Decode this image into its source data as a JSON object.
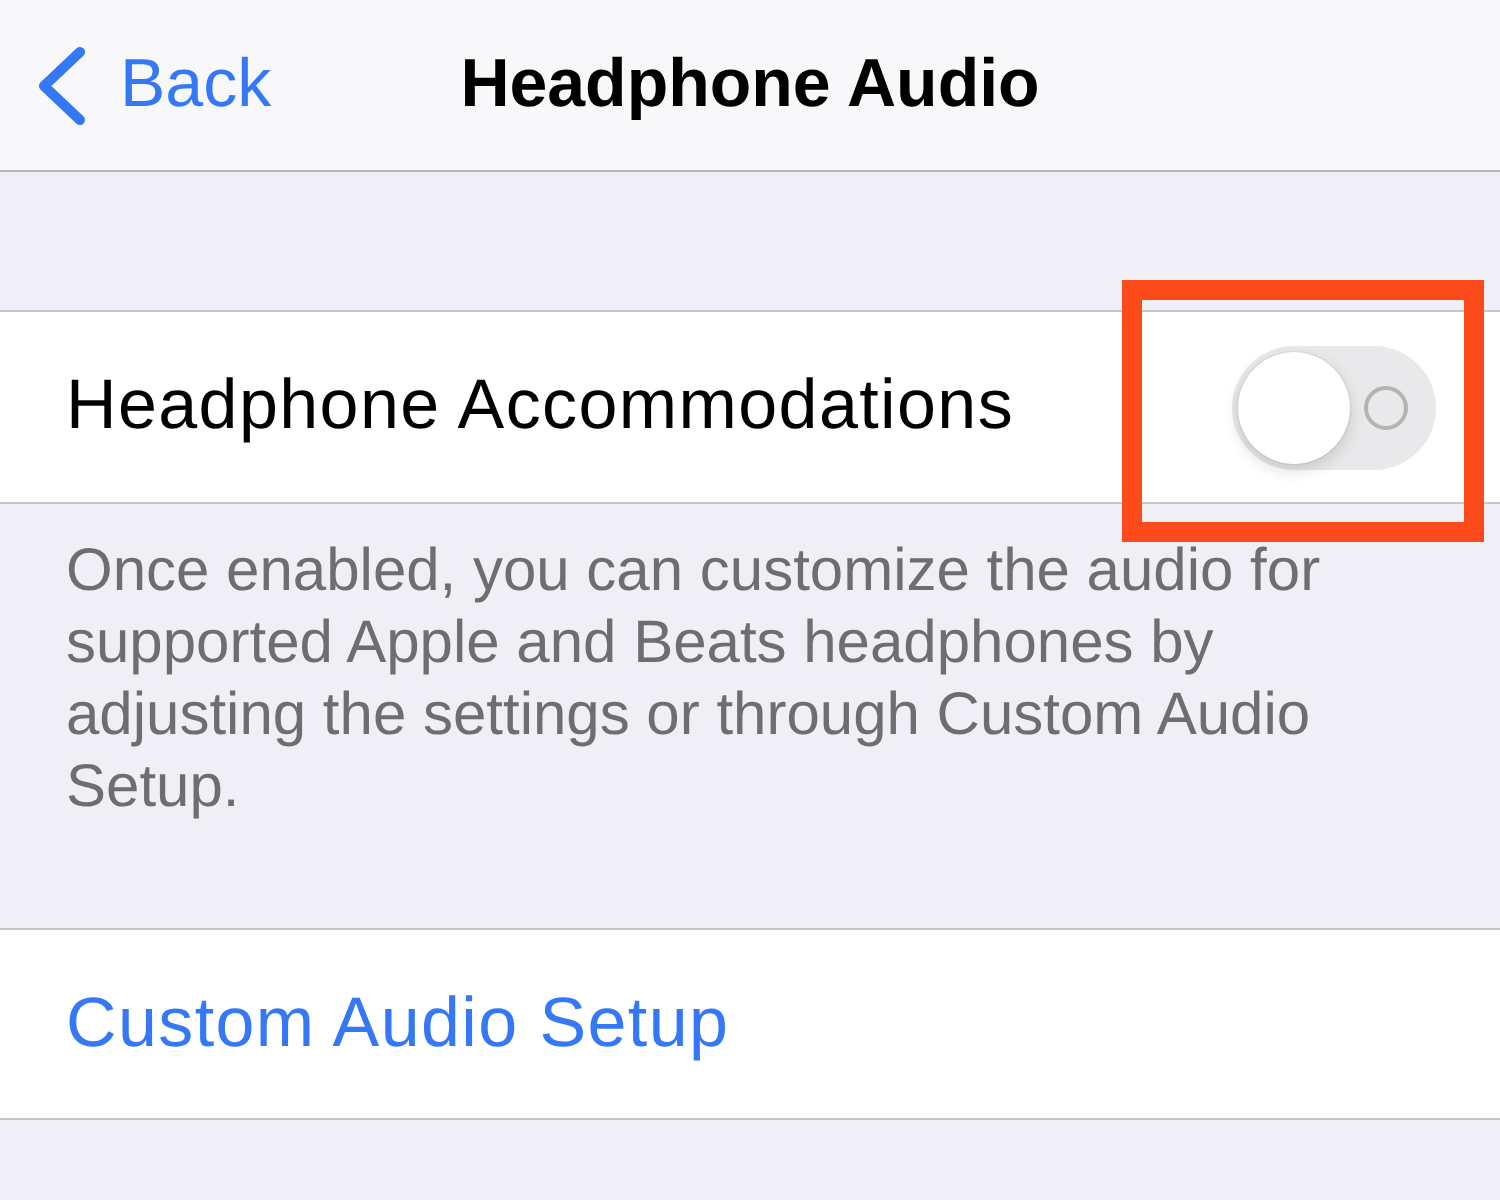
{
  "nav_bar": {
    "back_label": "Back",
    "title": "Headphone Audio"
  },
  "sections": [
    {
      "rows": [
        {
          "kind": "toggle",
          "label": "Headphone Accommodations",
          "on": false,
          "highlighted": true
        }
      ],
      "footer": "Once enabled, you can customize the audio for supported Apple and Beats headphones by adjusting the settings or through Custom Audio Setup."
    },
    {
      "rows": [
        {
          "kind": "link",
          "label": "Custom Audio Setup"
        }
      ]
    }
  ]
}
